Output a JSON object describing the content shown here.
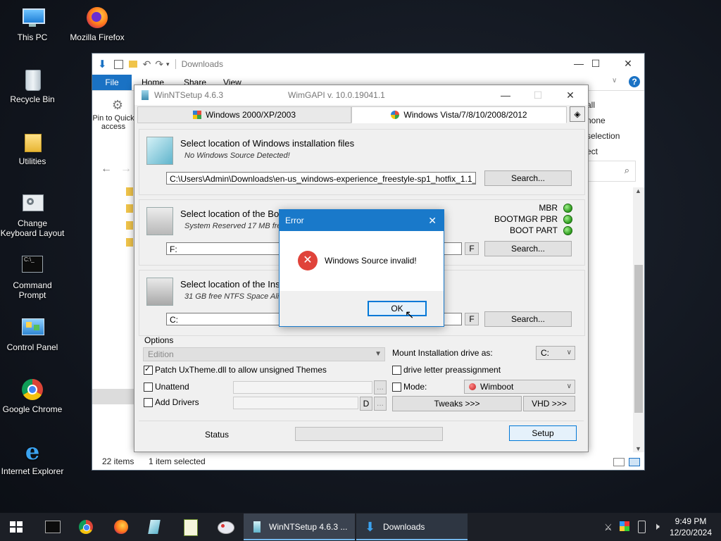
{
  "desktop": {
    "icons": [
      {
        "label": "This PC"
      },
      {
        "label": "Mozilla Firefox"
      },
      {
        "label": "Recycle Bin"
      },
      {
        "label": "Utilities"
      },
      {
        "label": "Change Keyboard Layout"
      },
      {
        "label": "Command Prompt"
      },
      {
        "label": "Control Panel"
      },
      {
        "label": "Google Chrome"
      },
      {
        "label": "Internet Explorer"
      }
    ]
  },
  "explorer": {
    "title": "Downloads",
    "ribbon": {
      "file": "File",
      "home": "Home",
      "share": "Share",
      "view": "View"
    },
    "pin_label": "Pin to Quick access",
    "right_frag": {
      "a": "all",
      "b": "none",
      "c": "selection",
      "d": "ect"
    },
    "status_items": "22 items",
    "status_selected": "1 item selected"
  },
  "wntsetup": {
    "title": "WinNTSetup 4.6.3",
    "api": "WimGAPI v. 10.0.19041.1",
    "tabs": [
      "Windows 2000/XP/2003",
      "Windows Vista/7/8/10/2008/2012"
    ],
    "source": {
      "title": "Select location of Windows installation files",
      "status": "No Windows Source Detected!",
      "path": "C:\\Users\\Admin\\Downloads\\en-us_windows-experience_freestyle-sp1_hotfix_1.1_",
      "search": "Search..."
    },
    "boot": {
      "title": "Select location of the Bo",
      "status": "System Reserved 17 MB free",
      "path": "F:",
      "f": "F",
      "search": "Search...",
      "leds": [
        "MBR",
        "BOOTMGR PBR",
        "BOOT PART"
      ]
    },
    "install": {
      "title": "Select location of the Ins",
      "status": "31 GB free NTFS Space Align",
      "path": "C:",
      "f": "F",
      "search": "Search..."
    },
    "options": {
      "label": "Options",
      "edition": "Edition",
      "mount_label": "Mount Installation drive as:",
      "mount_value": "C:",
      "patch": "Patch UxTheme.dll to allow unsigned Themes",
      "drive_letter": "drive letter preassignment",
      "unattend": "Unattend",
      "mode": "Mode:",
      "mode_value": "Wimboot",
      "add_drivers": "Add Drivers",
      "d": "D",
      "dots": "...",
      "tweaks": "Tweaks >>>",
      "vhd": "VHD >>>"
    },
    "status_label": "Status",
    "setup": "Setup"
  },
  "error_dialog": {
    "title": "Error",
    "message": "Windows Source invalid!",
    "ok": "OK"
  },
  "taskbar": {
    "apps": [
      {
        "label": "WinNTSetup 4.6.3 ..."
      },
      {
        "label": "Downloads"
      }
    ],
    "time": "9:49 PM",
    "date": "12/20/2024"
  }
}
